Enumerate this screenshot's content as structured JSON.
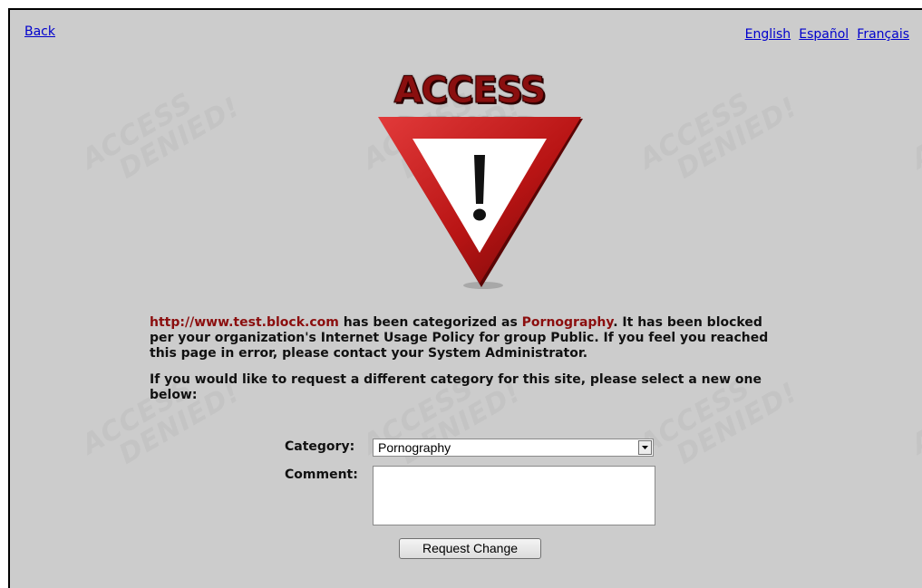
{
  "nav": {
    "back": "Back",
    "languages": [
      "English",
      "Español",
      "Français"
    ]
  },
  "watermark": {
    "line1": "ACCESS",
    "line2": "DENIED!"
  },
  "header": {
    "title": "ACCESS DENIED"
  },
  "message": {
    "url": "http://www.test.block.com",
    "text1": " has been categorized as ",
    "category": "Pornography",
    "text2": ". It has been blocked per your organization's Internet Usage Policy for group Public. If you feel you reached this page in error, please contact your System Administrator.",
    "request": "If you would like to request a different category for this site, please select a new one below:"
  },
  "form": {
    "category_label": "Category:",
    "category_value": "Pornography",
    "comment_label": "Comment:",
    "comment_value": "",
    "submit": "Request Change"
  },
  "colors": {
    "background": "#cccccc",
    "accent": "#8b0e0e",
    "link": "#0000cc"
  }
}
